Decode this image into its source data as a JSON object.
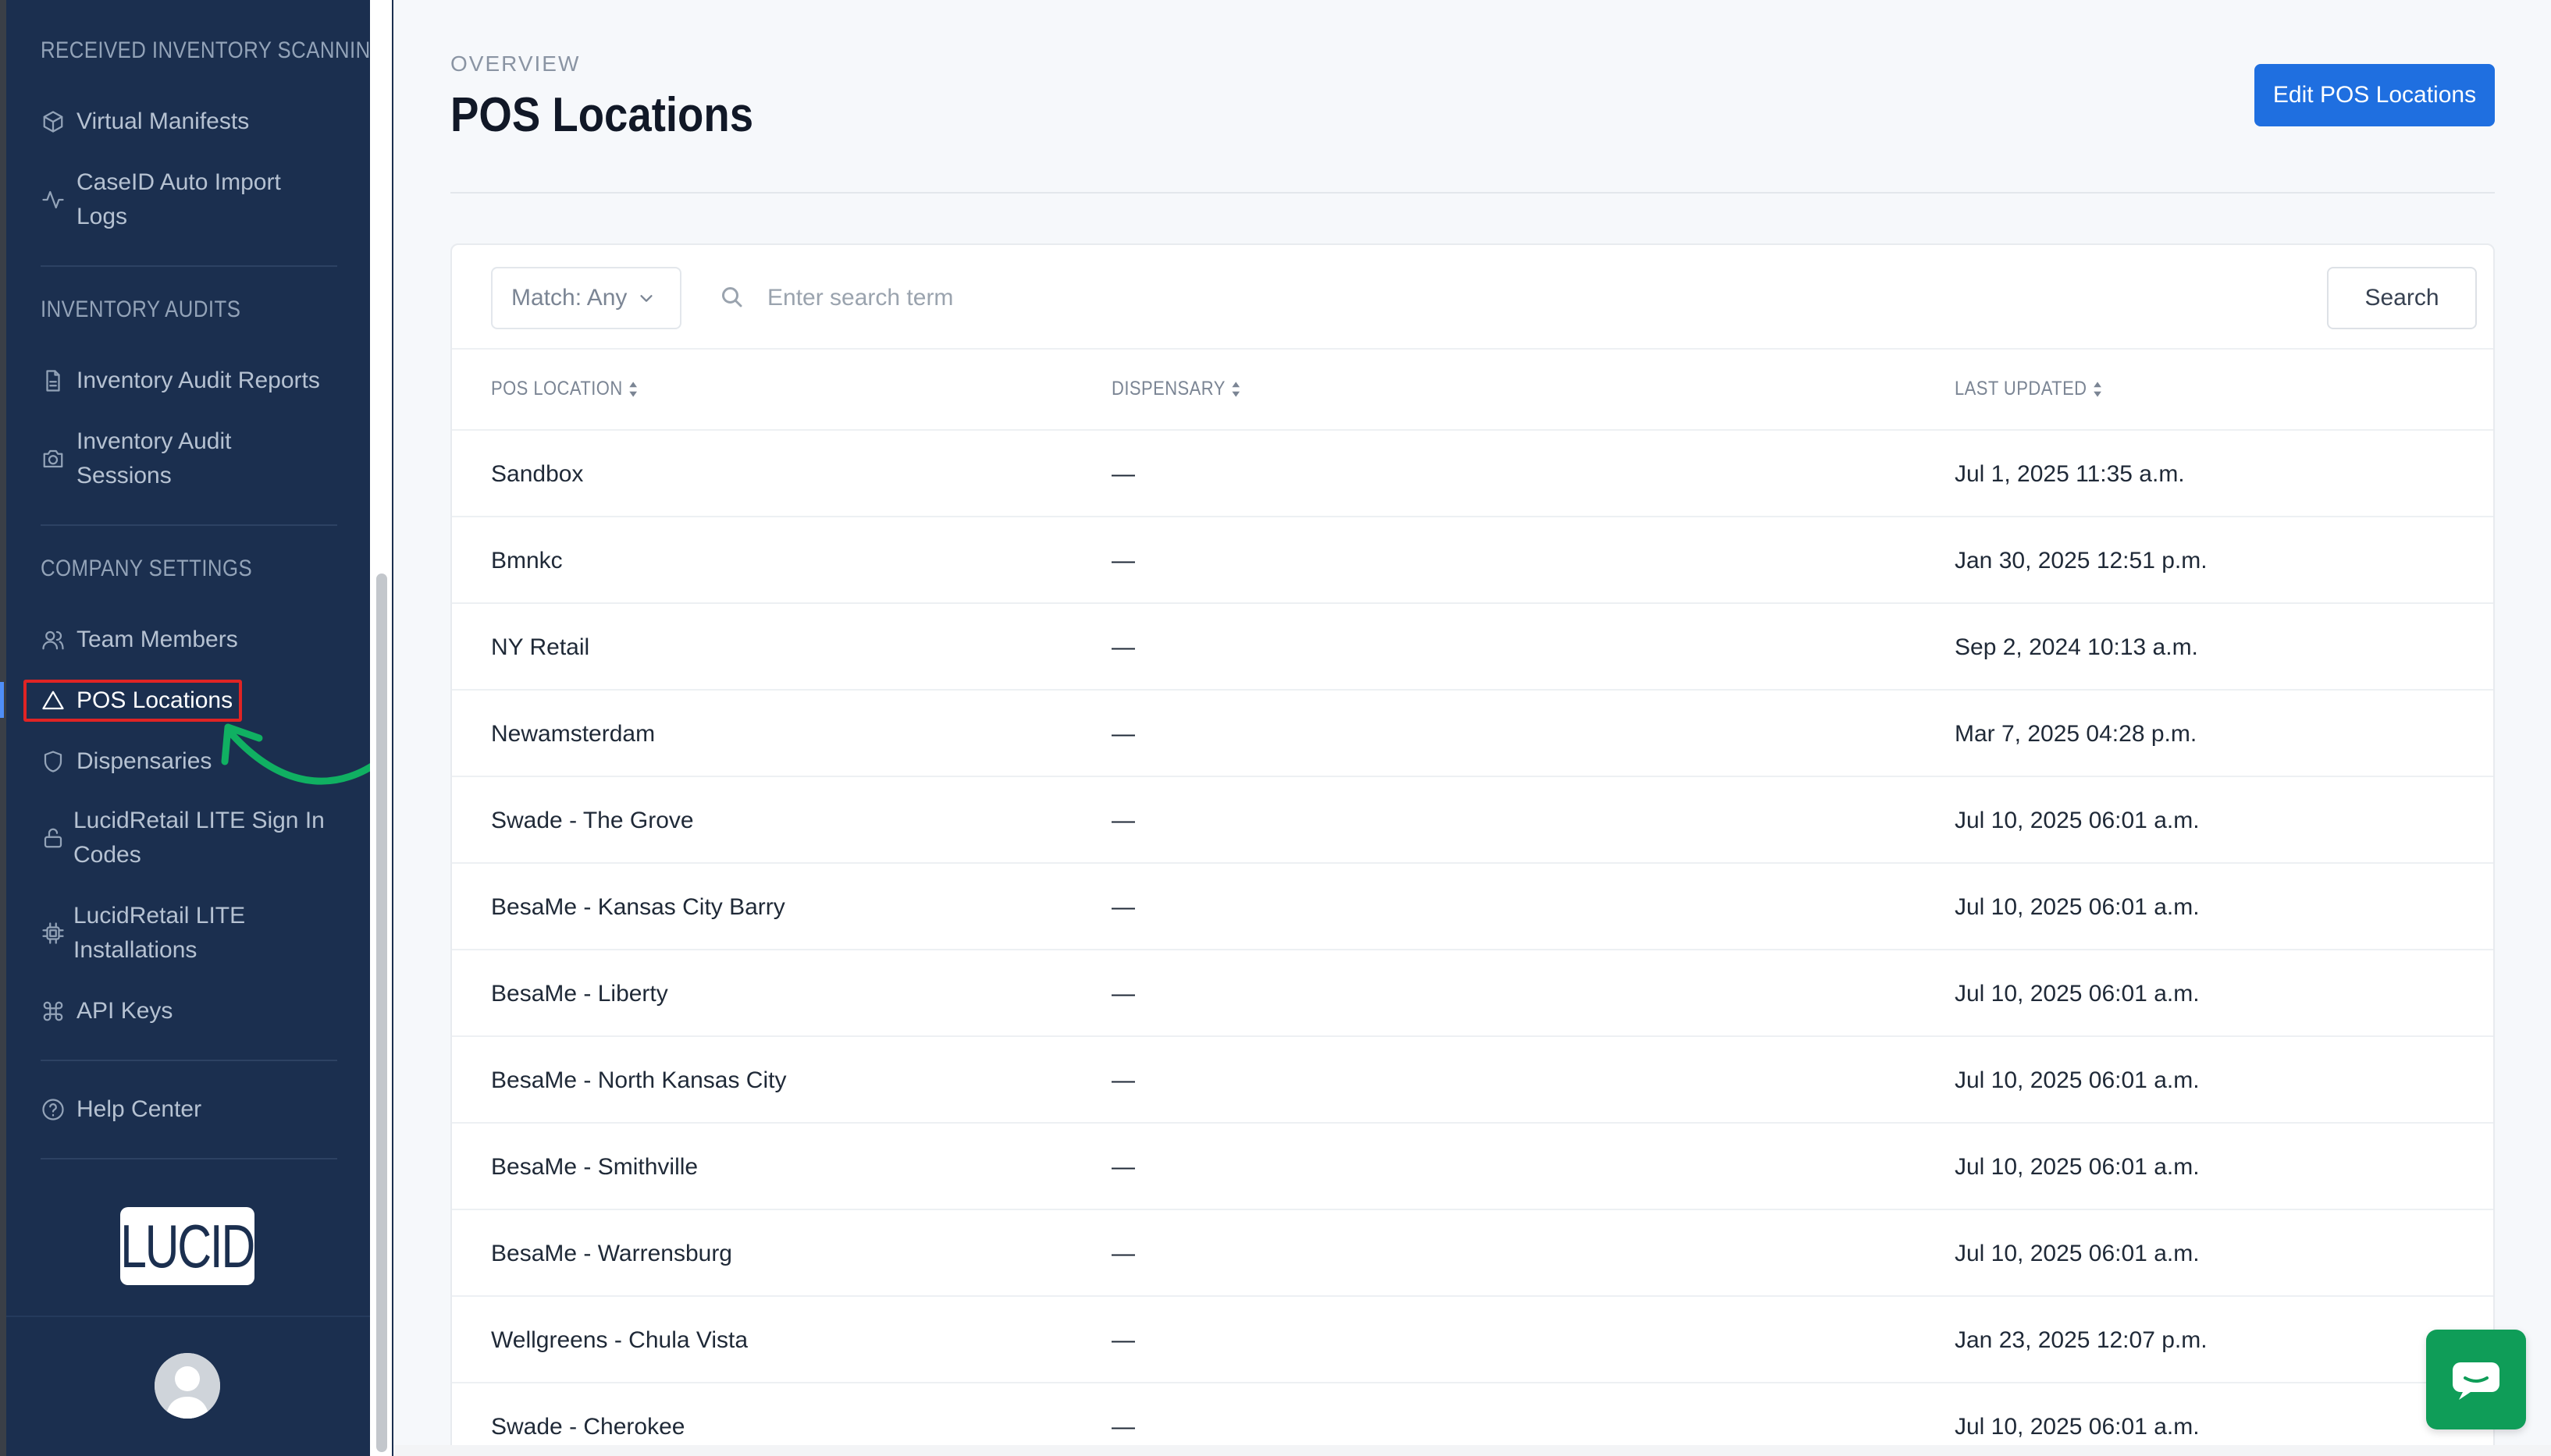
{
  "sidebar": {
    "sections": [
      {
        "heading": "RECEIVED INVENTORY SCANNING",
        "items": [
          {
            "label": "Virtual Manifests",
            "icon": "box-icon"
          },
          {
            "label": "CaseID Auto Import Logs",
            "icon": "activity-icon"
          }
        ]
      },
      {
        "heading": "INVENTORY AUDITS",
        "items": [
          {
            "label": "Inventory Audit Reports",
            "icon": "file-icon"
          },
          {
            "label": "Inventory Audit Sessions",
            "icon": "camera-icon"
          }
        ]
      },
      {
        "heading": "COMPANY SETTINGS",
        "items": [
          {
            "label": "Team Members",
            "icon": "users-icon"
          },
          {
            "label": "POS Locations",
            "icon": "triangle-icon",
            "active": true
          },
          {
            "label": "Dispensaries",
            "icon": "shield-icon"
          },
          {
            "label": "LucidRetail LITE Sign In Codes",
            "icon": "lock-icon"
          },
          {
            "label": "LucidRetail LITE Installations",
            "icon": "cpu-icon"
          },
          {
            "label": "API Keys",
            "icon": "command-icon"
          }
        ]
      }
    ],
    "help": {
      "label": "Help Center",
      "icon": "help-circle-icon"
    },
    "logo_text": "LUCID",
    "active_color": "#ffffff",
    "highlight_color": "#e02424",
    "arrow_color": "#10b062"
  },
  "header": {
    "overline": "OVERVIEW",
    "title": "POS Locations",
    "edit_button": "Edit POS Locations"
  },
  "filter": {
    "match_label": "Match: Any",
    "search_placeholder": "Enter search term",
    "search_button": "Search"
  },
  "table": {
    "columns": [
      "POS LOCATION",
      "DISPENSARY",
      "LAST UPDATED"
    ],
    "rows": [
      {
        "location": "Sandbox",
        "dispensary": "—",
        "updated": "Jul 1, 2025 11:35 a.m."
      },
      {
        "location": "Bmnkc",
        "dispensary": "—",
        "updated": "Jan 30, 2025 12:51 p.m."
      },
      {
        "location": "NY Retail",
        "dispensary": "—",
        "updated": "Sep 2, 2024 10:13 a.m."
      },
      {
        "location": "Newamsterdam",
        "dispensary": "—",
        "updated": "Mar 7, 2025 04:28 p.m."
      },
      {
        "location": "Swade - The Grove",
        "dispensary": "—",
        "updated": "Jul 10, 2025 06:01 a.m."
      },
      {
        "location": "BesaMe - Kansas City Barry",
        "dispensary": "—",
        "updated": "Jul 10, 2025 06:01 a.m."
      },
      {
        "location": "BesaMe - Liberty",
        "dispensary": "—",
        "updated": "Jul 10, 2025 06:01 a.m."
      },
      {
        "location": "BesaMe - North Kansas City",
        "dispensary": "—",
        "updated": "Jul 10, 2025 06:01 a.m."
      },
      {
        "location": "BesaMe - Smithville",
        "dispensary": "—",
        "updated": "Jul 10, 2025 06:01 a.m."
      },
      {
        "location": "BesaMe - Warrensburg",
        "dispensary": "—",
        "updated": "Jul 10, 2025 06:01 a.m."
      },
      {
        "location": "Wellgreens - Chula Vista",
        "dispensary": "—",
        "updated": "Jan 23, 2025 12:07 p.m."
      },
      {
        "location": "Swade - Cherokee",
        "dispensary": "—",
        "updated": "Jul 10, 2025 06:01 a.m."
      }
    ]
  },
  "colors": {
    "sidebar_bg": "#1b2f4f",
    "primary": "#1f6fe0",
    "chat": "#0f9d58"
  }
}
